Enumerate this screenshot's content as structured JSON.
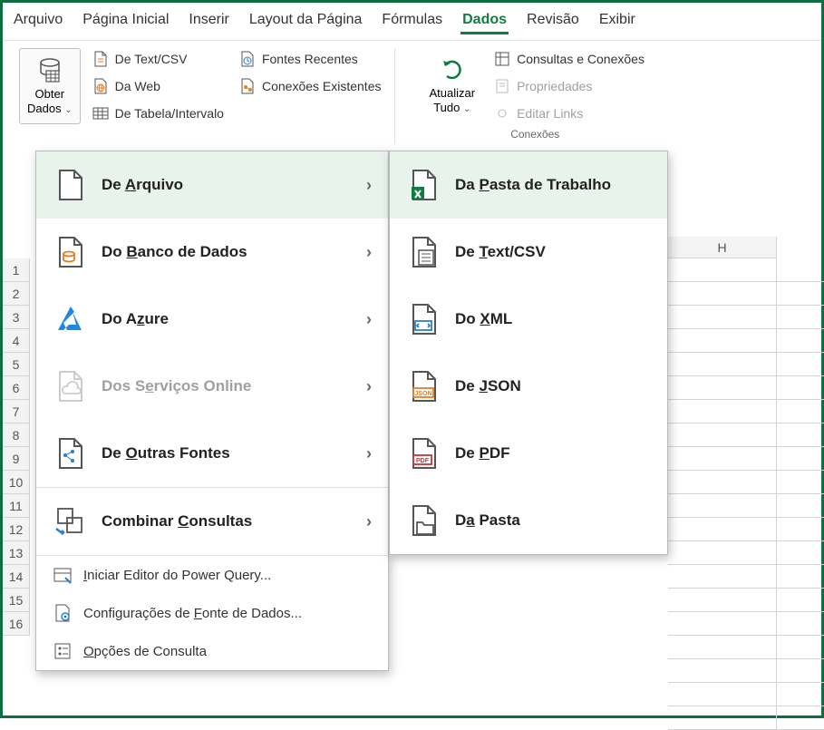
{
  "tabs": {
    "arquivo": "Arquivo",
    "pagina_inicial": "Página Inicial",
    "inserir": "Inserir",
    "layout": "Layout da Página",
    "formulas": "Fórmulas",
    "dados": "Dados",
    "revisao": "Revisão",
    "exibir": "Exibir"
  },
  "ribbon": {
    "get_data": {
      "line1": "Obter",
      "line2": "Dados"
    },
    "from_text_csv": "De Text/CSV",
    "from_web": "Da Web",
    "from_table_range": "De Tabela/Intervalo",
    "recent_sources": "Fontes Recentes",
    "existing_connections": "Conexões Existentes",
    "refresh_all": {
      "line1": "Atualizar",
      "line2": "Tudo"
    },
    "queries_connections": "Consultas e Conexões",
    "properties": "Propriedades",
    "edit_links": "Editar Links",
    "group2_label": "Conexões"
  },
  "menu1": {
    "from_file": "De Arquivo",
    "from_db": "Do Banco de Dados",
    "from_azure": "Do Azure",
    "from_online": "Dos Serviços Online",
    "from_other": "De Outras Fontes",
    "combine": "Combinar Consultas",
    "launch_pq": "Iniciar Editor do Power Query...",
    "data_source_settings": "Configurações de Fonte de Dados...",
    "query_options": "Opções de Consulta"
  },
  "menu2": {
    "from_workbook": "Da Pasta de Trabalho",
    "from_text_csv": "De Text/CSV",
    "from_xml": "Do XML",
    "from_json": "De JSON",
    "from_pdf": "De PDF",
    "from_folder": "Da Pasta"
  },
  "sheet": {
    "col_h": "H",
    "rows": [
      "1",
      "2",
      "3",
      "4",
      "5",
      "6",
      "7",
      "8",
      "9",
      "10",
      "11",
      "12",
      "13",
      "14",
      "15",
      "16"
    ]
  }
}
